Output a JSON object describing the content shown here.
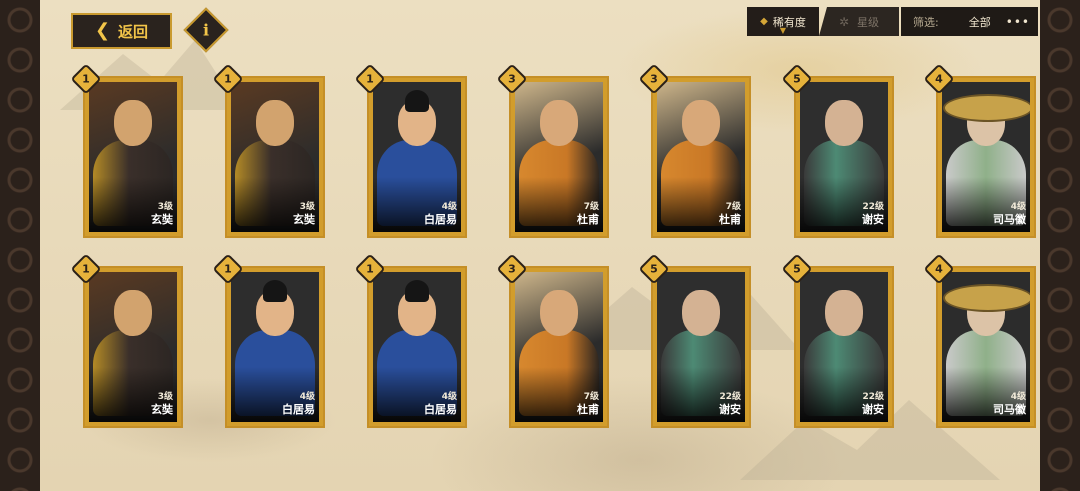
{
  "nav": {
    "back_label": "返回",
    "info_label": "i"
  },
  "sort": {
    "rarity_label": "稀有度",
    "star_label": "星级"
  },
  "filter": {
    "label": "筛选:",
    "value": "全部",
    "more": "•••"
  },
  "colors": {
    "accent_gold": "#c99a2f",
    "badge": "#e6b23b",
    "panel_dark": "#231d19"
  },
  "cards": [
    {
      "rarity": "1",
      "level": "3级",
      "name": "玄奘"
    },
    {
      "rarity": "1",
      "level": "3级",
      "name": "玄奘"
    },
    {
      "rarity": "1",
      "level": "4级",
      "name": "白居易"
    },
    {
      "rarity": "3",
      "level": "7级",
      "name": "杜甫"
    },
    {
      "rarity": "3",
      "level": "7级",
      "name": "杜甫"
    },
    {
      "rarity": "5",
      "level": "22级",
      "name": "谢安"
    },
    {
      "rarity": "4",
      "level": "4级",
      "name": "司马徽"
    },
    {
      "rarity": "1",
      "level": "3级",
      "name": "玄奘"
    },
    {
      "rarity": "1",
      "level": "4级",
      "name": "白居易"
    },
    {
      "rarity": "1",
      "level": "4级",
      "name": "白居易"
    },
    {
      "rarity": "3",
      "level": "7级",
      "name": "杜甫"
    },
    {
      "rarity": "5",
      "level": "22级",
      "name": "谢安"
    },
    {
      "rarity": "5",
      "level": "22级",
      "name": "谢安"
    },
    {
      "rarity": "4",
      "level": "4级",
      "name": "司马徽"
    }
  ]
}
